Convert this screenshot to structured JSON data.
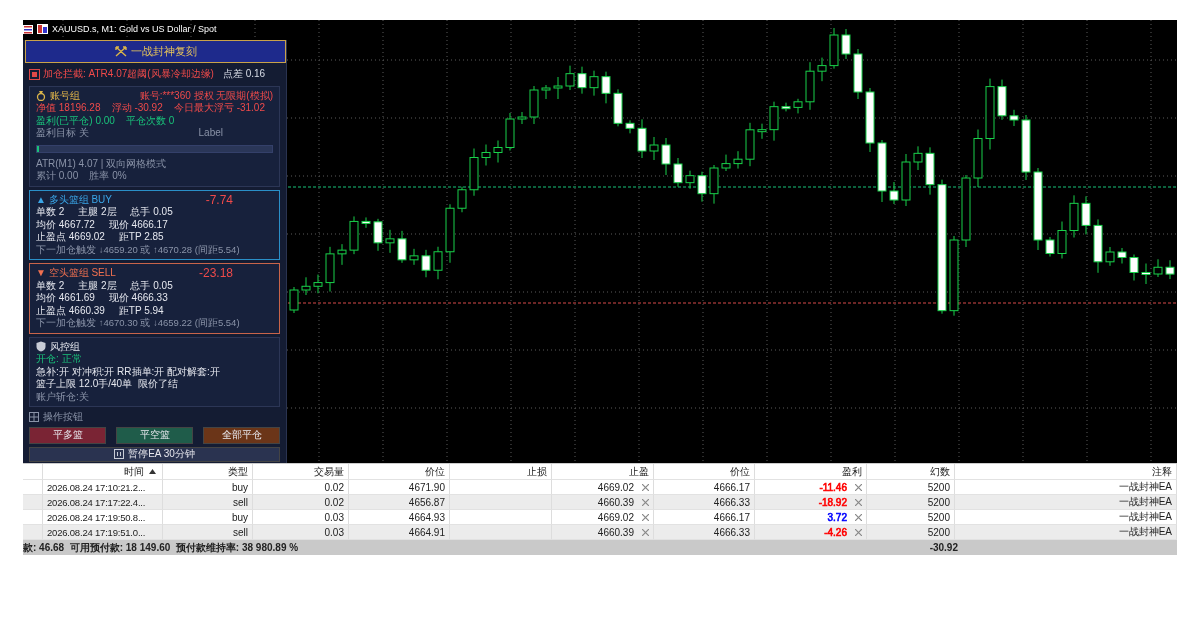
{
  "chart": {
    "title": "XAUUSD.s, M1:  Gold vs US Dollar / Spot"
  },
  "panel": {
    "title": "一战封神复刻",
    "alert": {
      "text": "加仓拦截: ATR4.07超阈(风暴冷却边缘)",
      "spread": "点差 0.16"
    },
    "account": {
      "title": "账号组",
      "info": "账号:***360 授权 无限期(模拟)",
      "lines": [
        {
          "kind": "loss",
          "text": "净值 18196.28    浮动 -30.92    今日最大浮亏 -31.02"
        },
        {
          "kind": "profit",
          "text": "盈利(已平仓) 0.00    平仓次数 0"
        }
      ],
      "target": "盈利目标 关",
      "target_label": "Label",
      "progress": {
        "level": 0.01
      },
      "notes": [
        "ATR(M1) 4.07 | 双向网格模式",
        "累计 0.00    胜率 0%"
      ]
    },
    "baskets": [
      {
        "kind": "buy",
        "arrow": "▲",
        "title": "多头篮组 BUY",
        "pnl": "-7.74",
        "lines": [
          "单数 2     主腿 2层     总手 0.05",
          "均价 4667.72     现价 4666.17",
          "止盈点 4669.02     距TP 2.85"
        ],
        "trigger": "下一加仓触发 ↓4659.20 或 ↑4670.28 (间距5.54)"
      },
      {
        "kind": "sell",
        "arrow": "▼",
        "title": "空头篮组 SELL",
        "pnl": "-23.18",
        "lines": [
          "单数 2     主腿 2层     总手 0.05",
          "均价 4661.69     现价 4666.33",
          "止盈点 4660.39     距TP 5.94"
        ],
        "trigger": "下一加仓触发 ↑4670.30 或 ↓4659.22 (间距5.54)"
      }
    ],
    "risk": {
      "title": "风控组",
      "status": "开仓: 正常",
      "lines": [
        "急补:开 对冲积:开 RR插单:开 配对解套:开",
        "篮子上限 12.0手/40单  限价了结"
      ],
      "note": "账户斩仓:关"
    },
    "actions_label": "操作按钮",
    "buttons": [
      {
        "kind": "close-long",
        "label": "平多篮"
      },
      {
        "kind": "close-short",
        "label": "平空篮"
      },
      {
        "kind": "close-all",
        "label": "全部平仓"
      }
    ],
    "pause_button": "暂停EA 30分钟"
  },
  "table": {
    "columns": [
      {
        "label": "时间",
        "sorted": true
      },
      {
        "label": "类型",
        "sorted": false
      },
      {
        "label": "交易量",
        "sorted": false
      },
      {
        "label": "价位",
        "sorted": false
      },
      {
        "label": "止损",
        "sorted": false
      },
      {
        "label": "止盈",
        "sorted": false
      },
      {
        "label": "价位",
        "sorted": false
      },
      {
        "label": "盈利",
        "sorted": false
      },
      {
        "label": "幻数",
        "sorted": false
      },
      {
        "label": "注释",
        "sorted": false
      }
    ],
    "rows": [
      {
        "time": "2026.08.24 17:10:21.2...",
        "type": "buy",
        "volume": "0.02",
        "price": "4671.90",
        "take_profit": "4669.02",
        "current_price": "4666.17",
        "profit": "-11.46",
        "color": "#ff0000",
        "magic": "5200",
        "comment": "一战封神EA"
      },
      {
        "time": "2026.08.24 17:17:22.4...",
        "type": "sell",
        "volume": "0.02",
        "price": "4656.87",
        "take_profit": "4660.39",
        "current_price": "4666.33",
        "profit": "-18.92",
        "color": "#ff0000",
        "magic": "5200",
        "comment": "一战封神EA"
      },
      {
        "time": "2026.08.24 17:19:50.8...",
        "type": "buy",
        "volume": "0.03",
        "price": "4664.93",
        "take_profit": "4669.02",
        "current_price": "4666.17",
        "profit": "3.72",
        "color": "#0000ff",
        "magic": "5200",
        "comment": "一战封神EA"
      },
      {
        "time": "2026.08.24 17:19:51.0...",
        "type": "sell",
        "volume": "0.03",
        "price": "4664.91",
        "take_profit": "4660.39",
        "current_price": "4666.33",
        "profit": "-4.26",
        "color": "#ff0000",
        "magic": "5200",
        "comment": "一战封神EA"
      }
    ],
    "summary": {
      "account_line": "款: 46.68  可用预付款: 18 149.60  预付款维持率: 38 980.89 %",
      "total_profit": "-30.92"
    }
  }
}
